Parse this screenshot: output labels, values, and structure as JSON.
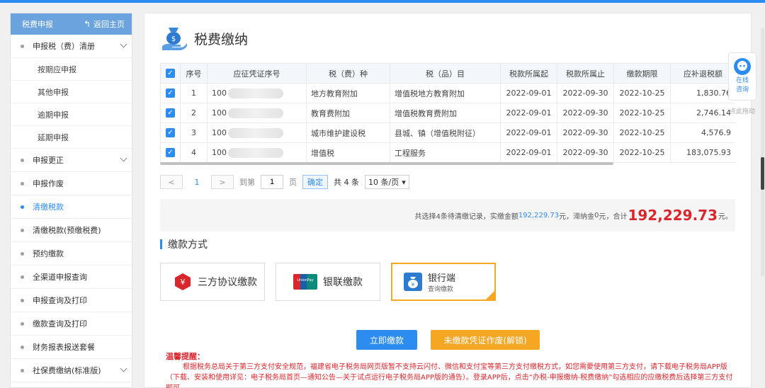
{
  "sidebar": {
    "header_title": "税费申报",
    "back_label": "返回主页",
    "items": [
      {
        "label": "申报税（费）清册",
        "expandable": true
      },
      {
        "label": "按期应申报",
        "sub": true
      },
      {
        "label": "其他申报",
        "sub": true
      },
      {
        "label": "逾期申报",
        "sub": true
      },
      {
        "label": "延期申报",
        "sub": true
      },
      {
        "label": "申报更正",
        "expandable": true
      },
      {
        "label": "申报作废"
      },
      {
        "label": "清缴税款",
        "active": true
      },
      {
        "label": "清缴税款(预缴税费)"
      },
      {
        "label": "预约缴款"
      },
      {
        "label": "全渠道申报查询"
      },
      {
        "label": "申报查询及打印"
      },
      {
        "label": "缴款查询及打印"
      },
      {
        "label": "财务报表报送套餐"
      },
      {
        "label": "社保费缴纳(标准版)",
        "expandable": true
      }
    ]
  },
  "page": {
    "title": "税费缴纳"
  },
  "table": {
    "headers": [
      "序号",
      "应征凭证序号",
      "税（费）种",
      "税（品）目",
      "税款所属起",
      "税款所属止",
      "缴款期限",
      "应补退税额"
    ],
    "rows": [
      {
        "no": "1",
        "voucher": "100",
        "tax": "地方教育附加",
        "item": "增值税地方教育附加",
        "start": "2022-09-01",
        "end": "2022-09-30",
        "deadline": "2022-10-25",
        "amount": "1,830.76"
      },
      {
        "no": "2",
        "voucher": "100",
        "tax": "教育费附加",
        "item": "增值税教育费附加",
        "start": "2022-09-01",
        "end": "2022-09-30",
        "deadline": "2022-10-25",
        "amount": "2,746.14"
      },
      {
        "no": "3",
        "voucher": "100",
        "tax": "城市维护建设税",
        "item": "县城、镇（增值税附征）",
        "start": "2022-09-01",
        "end": "2022-09-30",
        "deadline": "2022-10-25",
        "amount": "4,576.9"
      },
      {
        "no": "4",
        "voucher": "100",
        "tax": "增值税",
        "item": "工程服务",
        "start": "2022-09-01",
        "end": "2022-09-30",
        "deadline": "2022-10-25",
        "amount": "183,075.93"
      }
    ]
  },
  "pager": {
    "current": "1",
    "goto_label": "到第",
    "goto_value": "1",
    "page_unit": "页",
    "confirm": "确定",
    "total": "共 4 条",
    "page_size": "10 条/页"
  },
  "summary": {
    "pre": "共选择4条待清缴记录，实缴金额",
    "paid": "192,229.73",
    "mid": "元，滞纳金",
    "late_fee": "0",
    "mid2": "元，合计",
    "total": "192,229.73",
    "suffix": "元。"
  },
  "payment": {
    "section_title": "缴款方式",
    "methods": [
      {
        "label": "三方协议缴款"
      },
      {
        "label": "银联缴款",
        "logo_text": "UnionPay"
      },
      {
        "label": "银行端",
        "sub": "查询缴款",
        "selected": true
      }
    ]
  },
  "buttons": {
    "pay_now": "立即缴款",
    "void_voucher": "未缴款凭证作废(解锁)"
  },
  "reminder": {
    "title": "温馨提醒：",
    "text": "根据税务总局关于第三方支付安全规范，福建省电子税务局网页版暂不支持云闪付、微信和支付宝等第三方支付缴税方式，如您需要使用第三方支付，请下载电子税务局APP版（下载、安装和使用详见：电子税务局首页—通知公告—关于试点运行电子税务局APP版的通告）。登录APP后，点击“办税-申报缴纳-税费缴纳”勾选相应的应缴税费后选择第三方支付即可。"
  },
  "float_widget": {
    "label_line1": "在线",
    "label_line2": "咨询",
    "drag_tip": "点此拖动"
  },
  "colors": {
    "primary": "#2d8cf0",
    "accent": "#f5a623",
    "alert": "#d9262c"
  }
}
